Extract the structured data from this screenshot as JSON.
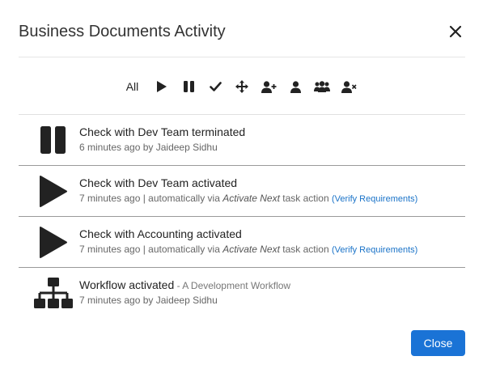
{
  "dialog": {
    "title": "Business Documents Activity",
    "close_label": "Close"
  },
  "filters": {
    "all_label": "All",
    "icons": [
      "play-icon",
      "pause-icon",
      "check-icon",
      "move-arrows-icon",
      "user-add-icon",
      "user-icon",
      "users-group-icon",
      "user-remove-icon"
    ]
  },
  "activities": [
    {
      "icon": "pause-icon",
      "title": "Check with Dev Team terminated",
      "subtitle_prefix": "6 minutes ago by Jaideep Sidhu"
    },
    {
      "icon": "play-icon",
      "title": "Check with Dev Team activated",
      "subtitle_prefix": "7 minutes ago | automatically via ",
      "subtitle_em": "Activate Next",
      "subtitle_suffix": " task action ",
      "link": "(Verify Requirements)"
    },
    {
      "icon": "play-icon",
      "title": "Check with Accounting activated",
      "subtitle_prefix": "7 minutes ago | automatically via ",
      "subtitle_em": "Activate Next",
      "subtitle_suffix": " task action ",
      "link": "(Verify Requirements)"
    },
    {
      "icon": "workflow-hierarchy-icon",
      "title": "Workflow activated",
      "title_suffix": " - A Development Workflow",
      "subtitle_prefix": "7 minutes ago by Jaideep Sidhu"
    }
  ],
  "colors": {
    "primary": "#1a73d6",
    "link": "#1a73c8",
    "icon": "#222222"
  }
}
